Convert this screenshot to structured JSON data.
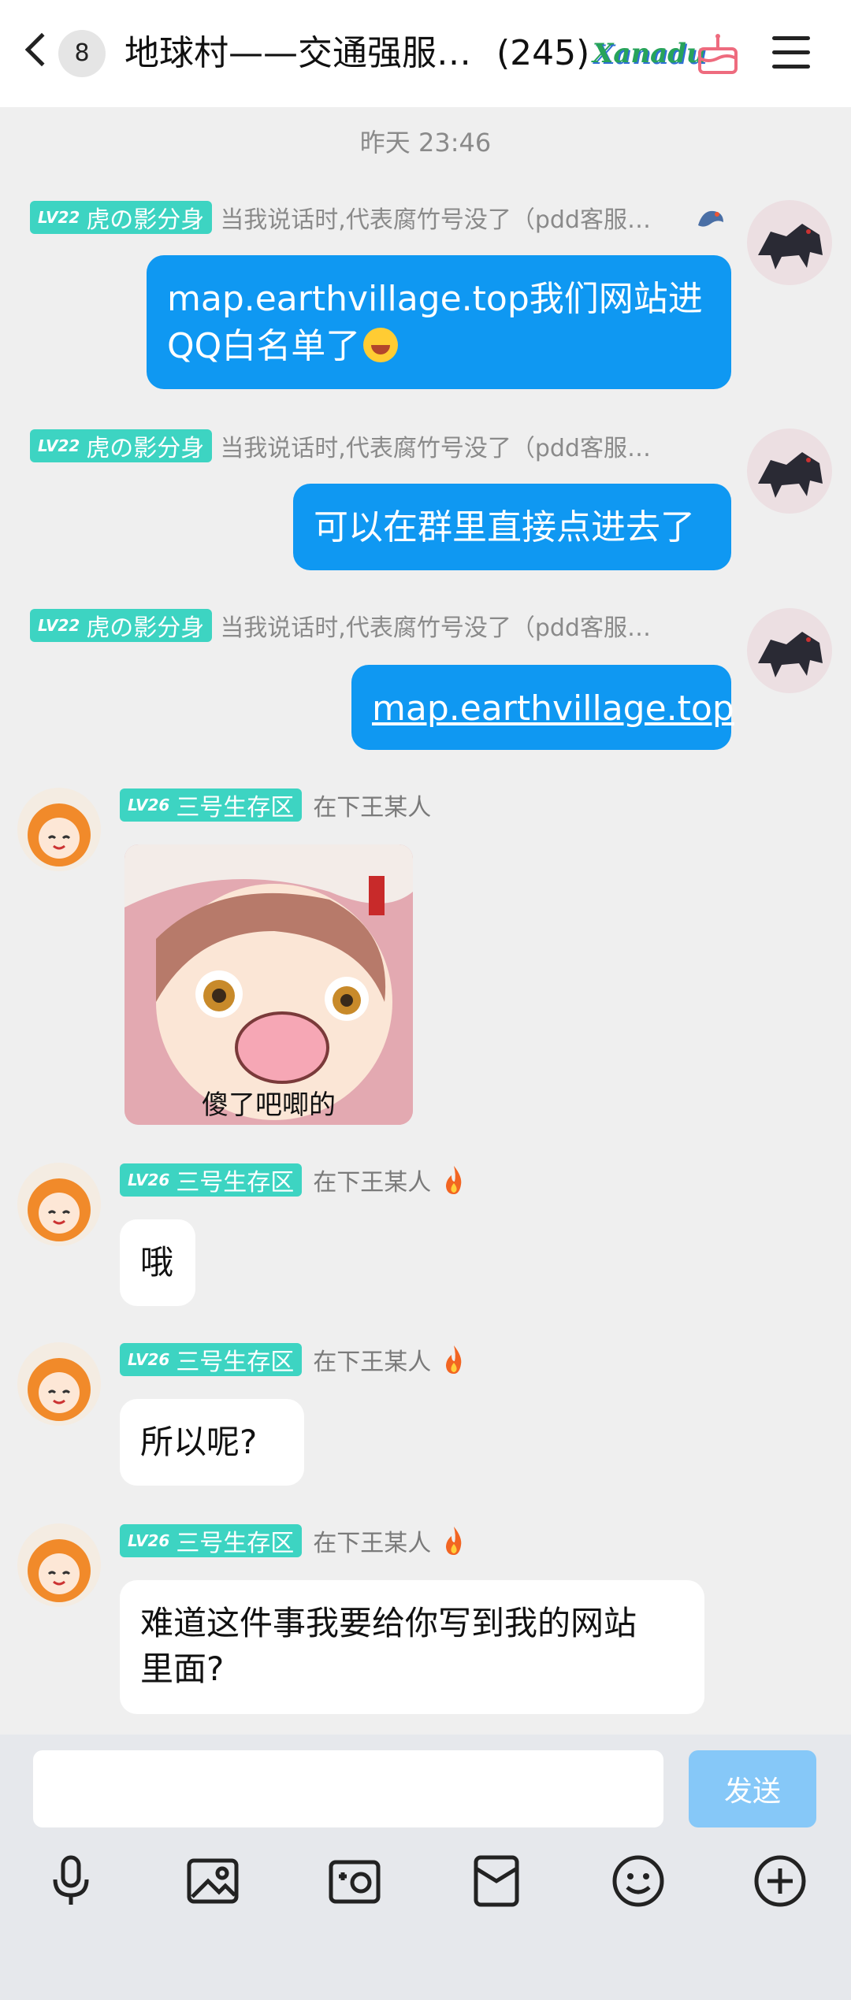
{
  "header": {
    "unread_count": "8",
    "title": "地球村——交通强服…",
    "member_count": "(245)",
    "logo_text": "Xanadu"
  },
  "timestamp": "昨天 23:46",
  "self_messages": [
    {
      "level": "LV22",
      "title_tag": "虎の影分身",
      "nickname": "当我说话时,代表腐竹号没了（pdd客服…",
      "line1": "map.earthvillage.top我们网站进",
      "line2": "QQ白名单了",
      "emoji": "laughing-emoji"
    },
    {
      "level": "LV22",
      "title_tag": "虎の影分身",
      "nickname": "当我说话时,代表腐竹号没了（pdd客服…",
      "text": "可以在群里直接点进去了"
    },
    {
      "level": "LV22",
      "title_tag": "虎の影分身",
      "nickname": "当我说话时,代表腐竹号没了（pdd客服…",
      "text": "map.earthvillage.top"
    }
  ],
  "other_messages": [
    {
      "level": "LV26",
      "title_tag": "三号生存区",
      "nickname": "在下王某人",
      "sticker_caption": "傻了吧唧的"
    },
    {
      "level": "LV26",
      "title_tag": "三号生存区",
      "nickname": "在下王某人",
      "text": "哦"
    },
    {
      "level": "LV26",
      "title_tag": "三号生存区",
      "nickname": "在下王某人",
      "text": "所以呢?"
    },
    {
      "level": "LV26",
      "title_tag": "三号生存区",
      "nickname": "在下王某人",
      "line1": "难道这件事我要给你写到我的网站",
      "line2": "里面?"
    }
  ],
  "input": {
    "value": "",
    "placeholder": "",
    "send_label": "发送"
  },
  "toolbar": [
    "microphone-icon",
    "image-icon",
    "camera-icon",
    "red-packet-icon",
    "emoji-icon",
    "plus-icon"
  ],
  "colors": {
    "self_bubble": "#0f98f2",
    "level_tag": "#3dd4c2",
    "send_button": "#86c8f8",
    "background": "#efefef"
  }
}
